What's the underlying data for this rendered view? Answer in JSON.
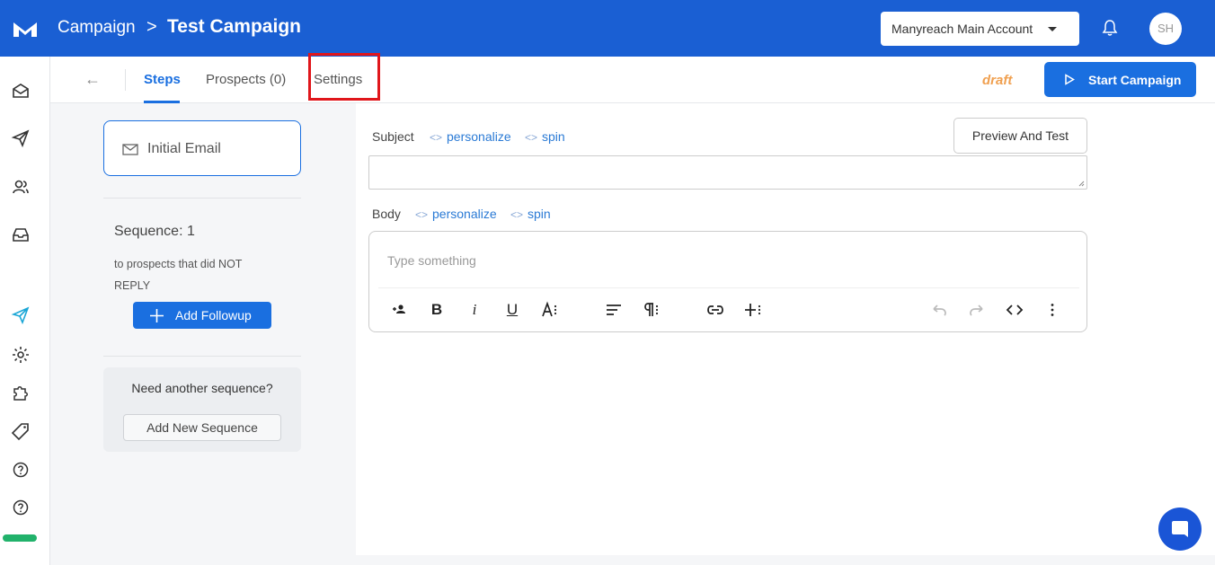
{
  "header": {
    "breadcrumb_root": "Campaign",
    "breadcrumb_sep": ">",
    "campaign_name": "Test Campaign",
    "account_select": "Manyreach Main Account",
    "avatar_initials": "SH"
  },
  "tabs": {
    "back": "←",
    "items": [
      {
        "label": "Steps"
      },
      {
        "label": "Prospects (0)"
      },
      {
        "label": "Settings"
      }
    ],
    "status": "draft",
    "start_button": "Start Campaign"
  },
  "steps": {
    "initial_email": "Initial Email",
    "sequence_title": "Sequence: 1",
    "sequence_desc": "to prospects that did NOT REPLY",
    "add_followup": "Add Followup",
    "need_another": "Need another sequence?",
    "add_new_sequence": "Add New Sequence"
  },
  "editor": {
    "subject_label": "Subject",
    "body_label": "Body",
    "personalize": "personalize",
    "spin": "spin",
    "preview_button": "Preview And Test",
    "body_placeholder": "Type something",
    "toolbar": [
      "user-plus-icon",
      "bold-icon",
      "italic-icon",
      "underline-icon",
      "font-size-icon",
      "align-icon",
      "paragraph-icon",
      "link-icon",
      "insert-icon",
      "undo-icon",
      "redo-icon",
      "code-icon",
      "more-icon"
    ]
  },
  "colors": {
    "brand": "#1a5fd3",
    "accent": "#1a6fe0",
    "draft": "#f0a050",
    "highlight": "#e0161b",
    "progress": "#21b26b"
  }
}
